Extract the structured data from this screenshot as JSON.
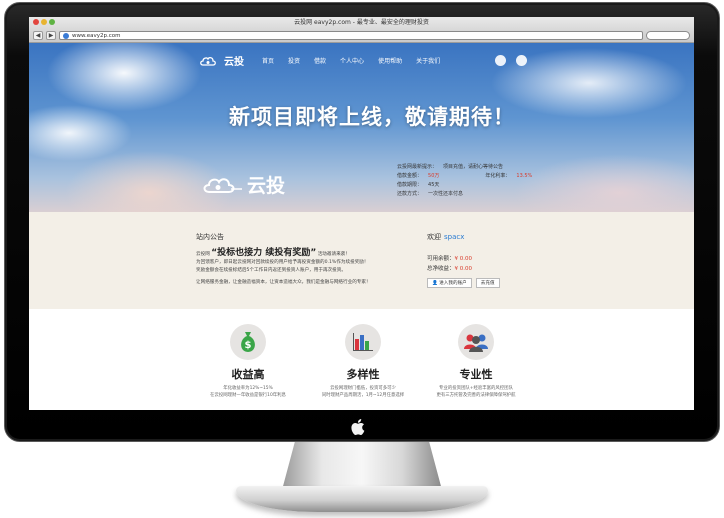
{
  "browser": {
    "window_title": "云投网 eavy2p.com - 最专业、最安全的理财投资",
    "url": "www.eavy2p.com",
    "back_label": "◀",
    "forward_label": "▶"
  },
  "site": {
    "logo_text": "云投",
    "nav_items": [
      "首页",
      "投资",
      "借款",
      "个人中心",
      "使用帮助",
      "关于我们"
    ],
    "headline": "新项目即将上线，敬请期待！",
    "project": {
      "row1_label": "云投网最新提示：",
      "row1_value": "项目充值，请耐心等待公告",
      "row2_label": "借款金额：",
      "row2_value": "50万",
      "row2b_label": "年化利率：",
      "row2b_value": "13.5%",
      "row3_label": "借款期限：",
      "row3_value": "45天",
      "row4_label": "还款方式：",
      "row4_value": "一次性还本付息"
    }
  },
  "notice": {
    "title": "站内公告",
    "brand": "云投网",
    "slogan": "“投标也接力 续投有奖励”",
    "slogan_tail": "活动邀请来袭！",
    "line1": "为回馈客户，即日起云投网对回款续投的用户给予再投资金额的0.1%作为续投奖励！",
    "line2": "奖励金额会在续投标结后5个工作日内返还到投资人账户，用于再次投资。",
    "line3": "让网络服务金融，让金融造福资本，让资本造福大众，我们是金融与网络行业的专家！"
  },
  "account": {
    "welcome_label": "欢迎",
    "username": "spacx",
    "available_label": "可用余额：",
    "available_value": "¥ 0.00",
    "income_label": "总净收益：",
    "income_value": "¥ 0.00",
    "enter_button": "进入我的账户",
    "recharge_button": "去充值"
  },
  "features": [
    {
      "title": "收益高",
      "desc1": "年化收益率为12%~15%",
      "desc2": "在云投网理财一年收益是银行10年利息",
      "icon": "money-bag-icon"
    },
    {
      "title": "多样性",
      "desc1": "云投网理财门槛低，投资可多可少",
      "desc2": "同时理财产品周期活，1月~12月任意选择",
      "icon": "bar-chart-icon"
    },
    {
      "title": "专业性",
      "desc1": "专业的投资团队+经验丰富的风控团队",
      "desc2": "更有三方托管及完善的法律保障保驾护航",
      "icon": "team-icon"
    }
  ],
  "colors": {
    "accent_blue": "#2a7bd1",
    "amount_red": "#d93b2b",
    "notice_bg": "#f3efe7"
  }
}
